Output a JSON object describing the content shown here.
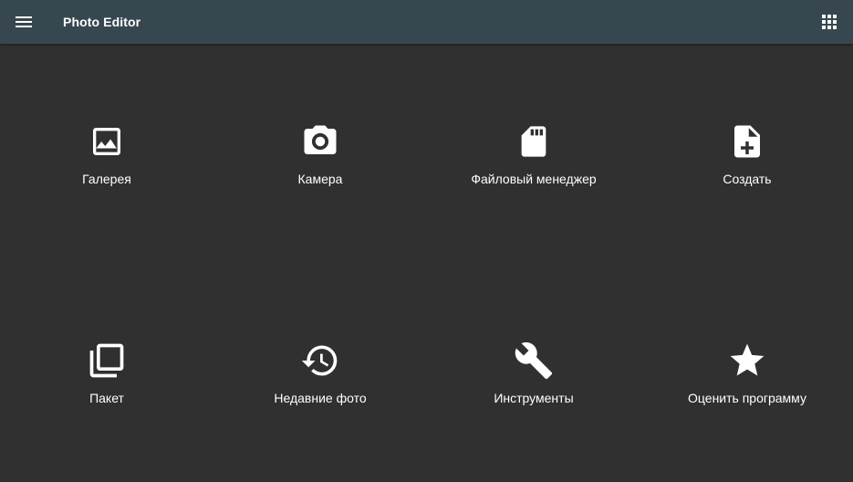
{
  "toolbar": {
    "title": "Photo Editor",
    "menu_icon": "hamburger-menu-icon",
    "apps_icon": "apps-grid-icon"
  },
  "tiles": [
    {
      "label": "Галерея",
      "icon": "image-icon"
    },
    {
      "label": "Камера",
      "icon": "camera-icon"
    },
    {
      "label": "Файловый менеджер",
      "icon": "sd-card-icon"
    },
    {
      "label": "Создать",
      "icon": "new-file-icon"
    },
    {
      "label": "Пакет",
      "icon": "batch-layers-icon"
    },
    {
      "label": "Недавние фото",
      "icon": "history-icon"
    },
    {
      "label": "Инструменты",
      "icon": "wrench-icon"
    },
    {
      "label": "Оценить программу",
      "icon": "star-icon"
    }
  ],
  "colors": {
    "toolbar_bg": "#37474f",
    "content_bg": "#303030",
    "foreground": "#ffffff"
  }
}
